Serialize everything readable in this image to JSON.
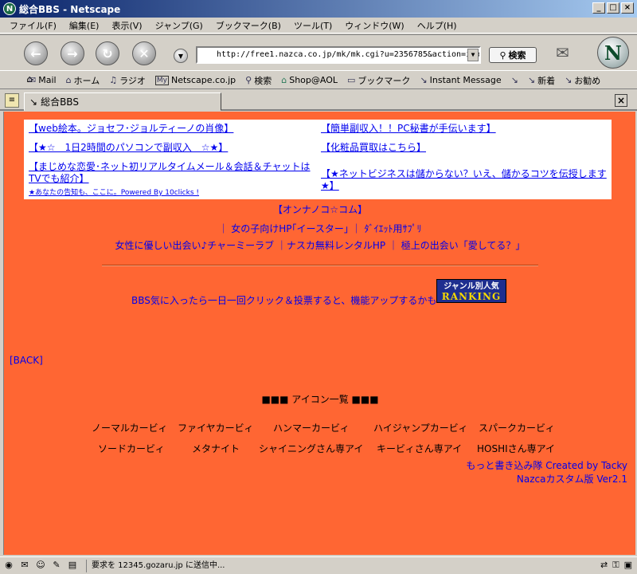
{
  "window": {
    "title": "総合BBS - Netscape",
    "app_icon": "N",
    "minimize": "_",
    "maximize": "□",
    "close": "×"
  },
  "menu": [
    "ファイル(F)",
    "編集(E)",
    "表示(V)",
    "ジャンプ(G)",
    "ブックマーク(B)",
    "ツール(T)",
    "ウィンドウ(W)",
    "ヘルプ(H)"
  ],
  "nav": {
    "url": "http://free1.nazca.co.jp/mk/mk.cgi?u=2356785&action=icondis",
    "search_label": "検索"
  },
  "bookmarks": [
    {
      "icon": "mail-icon",
      "glyph": "✉",
      "label": "Mail"
    },
    {
      "icon": "home-icon",
      "glyph": "⌂",
      "label": "ホーム"
    },
    {
      "icon": "radio-icon",
      "glyph": "♫",
      "label": "ラジオ"
    },
    {
      "icon": "my-icon",
      "glyph": "My",
      "label": "Netscape.co.jp"
    },
    {
      "icon": "search-icon",
      "glyph": "⚲",
      "label": "検索"
    },
    {
      "icon": "shop-icon",
      "glyph": "⌂",
      "label": "Shop@AOL"
    },
    {
      "icon": "folder-icon",
      "glyph": "▭",
      "label": "ブックマーク"
    },
    {
      "icon": "link-icon",
      "glyph": "↘",
      "label": "Instant Message"
    },
    {
      "icon": "link-icon",
      "glyph": "↘",
      "label": ""
    },
    {
      "icon": "link-icon",
      "glyph": "↘",
      "label": "新着"
    },
    {
      "icon": "link-icon",
      "glyph": "↘",
      "label": "お勧め"
    }
  ],
  "tab": {
    "title": "総合BBS",
    "close": "×"
  },
  "ads": {
    "left": [
      "【web絵本。ジョセフ･ジョルティーノの肖像】",
      "【★☆　1日2時間のパソコンで副収入　☆★】",
      "【まじめな恋愛･ネット初リアルタイムメール＆会話＆チャットはTVでも紹介】"
    ],
    "right": [
      "【簡単副収入！！PC秘書が手伝います】",
      "【化粧品買取はこちら】",
      "【★ネットビジネスは儲からない？いえ、儲かるコツを伝授します★】"
    ],
    "footer": "★あなたの告知も、ここに。Powered By 10clicks !"
  },
  "links": {
    "onnanoko": "【オンナノコ☆コム】",
    "line1": "｜ 女の子向けHP｢イースター｣ ｜ ﾀﾞｲｴｯﾄ用ｻﾌﾟﾘ",
    "line2": "女性に優しい出会い♪チャーミーラブ ｜ナスカ無料レンタルHP ｜ 極上の出会い「愛してる？」"
  },
  "ranking": {
    "text": "BBS気に入ったら一日一回クリック＆投票すると、機能アップするかも→",
    "badge_top": "ジャンル別人気",
    "badge_bottom": "RANKING"
  },
  "back": "[BACK]",
  "icons_title": "■■■ アイコン一覧 ■■■",
  "icon_list": [
    [
      "ノーマルカービィ",
      "ファイヤカービィ",
      "ハンマーカービィ",
      "ハイジャンプカービィ",
      "スパークカービィ"
    ],
    [
      "ソードカービィ",
      "メタナイト",
      "シャイニングさん専アイ",
      "キービィさん専アイ",
      "HOSHIさん専アイ"
    ]
  ],
  "credits": {
    "line1": "もっと書き込み隊 Created by Tacky",
    "line2": "Nazcaカスタム版 Ver2.1"
  },
  "status": {
    "text": "要求を 12345.gozaru.jp に送信中..."
  }
}
